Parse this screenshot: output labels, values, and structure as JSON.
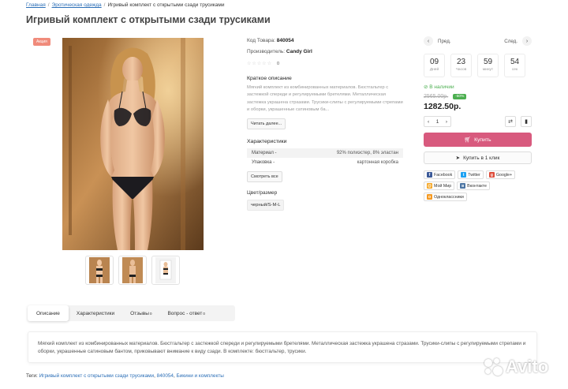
{
  "breadcrumbs": {
    "home": "Главная",
    "category": "Эротическая одежда",
    "current": "Игривый комплект с открытыми сзади трусиками"
  },
  "title": "Игривый комплект с открытыми сзади трусиками",
  "badge": "Акция",
  "product": {
    "sku_label": "Код Товара:",
    "sku": "840054",
    "brand_label": "Производитель:",
    "brand": "Candy Girl",
    "rating_count": "0",
    "short_title": "Краткое описание",
    "short_text": "Мягкий комплект из комбинированных материалов. Бюстгальтер с застежкой спереди и регулируемыми бретелями. Металлическая застежка украшена стразами. Трусики-слипы с регулируемыми стрепами и оборки, украшенные сатиновым ба...",
    "read_more": "Читать далее...",
    "chars_title": "Характеристики",
    "chars": [
      {
        "name": "Материал -",
        "value": "92% полиэстер, 8% эластан"
      },
      {
        "name": "Упаковка -",
        "value": "картонная коробка"
      }
    ],
    "show_all": "Смотреть все",
    "size_title": "Цвет/размер",
    "size_value": "черный/S-M-L"
  },
  "nav": {
    "prev": "Пред.",
    "next": "След."
  },
  "timer": [
    {
      "value": "09",
      "label": "Дней"
    },
    {
      "value": "23",
      "label": "Часов"
    },
    {
      "value": "59",
      "label": "минут"
    },
    {
      "value": "54",
      "label": "сек"
    }
  ],
  "stock": "В наличии",
  "old_price": "2565.00р.",
  "discount": "-50%",
  "price": "1282.50р.",
  "qty": "1",
  "buy_label": "Купить",
  "one_click_label": "Купить в 1 клик",
  "share": [
    {
      "label": "Facebook",
      "icon": "facebook-icon",
      "color": "#3b5998",
      "glyph": "f"
    },
    {
      "label": "Twitter",
      "icon": "twitter-icon",
      "color": "#1da1f2",
      "glyph": "t"
    },
    {
      "label": "Google+",
      "icon": "googleplus-icon",
      "color": "#dd4b39",
      "glyph": "g"
    },
    {
      "label": "Мой Мир",
      "icon": "moymir-icon",
      "color": "#f5a623",
      "glyph": "@"
    },
    {
      "label": "Вконтакте",
      "icon": "vk-icon",
      "color": "#4c75a3",
      "glyph": "в"
    },
    {
      "label": "Одноклассники",
      "icon": "ok-icon",
      "color": "#f59a23",
      "glyph": "о"
    }
  ],
  "tabs": [
    {
      "label": "Описание",
      "count": ""
    },
    {
      "label": "Характеристики",
      "count": ""
    },
    {
      "label": "Отзывы",
      "count": "0"
    },
    {
      "label": "Вопрос - ответ",
      "count": "0"
    }
  ],
  "description": "Мягкий комплект из комбинированных материалов. Бюстгальтер с застежкой спереди и регулируемыми бретелями. Металлическая застежка украшена стразами. Трусики-слипы с регулируемыми стрепами и оборки, украшенные сатиновым бантом, приковывают внимание к виду сзади. В комплекте: бюстгальтер, трусики.",
  "tags": {
    "label": "Теги:",
    "items": [
      "Игривый комплект с открытыми сзади трусиками",
      "840054",
      "Бикини и комплекты"
    ]
  },
  "watermark": "Avito"
}
